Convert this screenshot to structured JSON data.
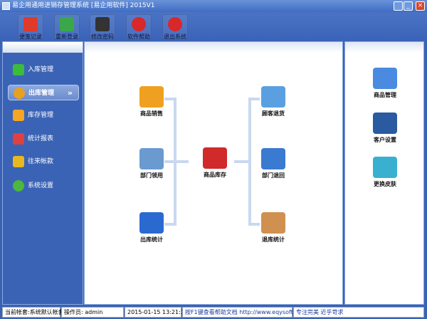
{
  "window": {
    "title": "易企用通用进销存管理系统 [易企用软件] 2015V1",
    "minimize": "_",
    "maximize": "□",
    "close": "×"
  },
  "toolbar": [
    {
      "label": "便笺记录",
      "icon": "notepad-icon",
      "color": "#e03a2a"
    },
    {
      "label": "重新登录",
      "icon": "users-icon",
      "color": "#3aa84a"
    },
    {
      "label": "修改密码",
      "icon": "magic-wand-icon",
      "color": "#333333"
    },
    {
      "label": "软件帮助",
      "icon": "help-icon",
      "color": "#d8282a"
    },
    {
      "label": "退出系统",
      "icon": "power-icon",
      "color": "#d8282a"
    }
  ],
  "sidebar": {
    "items": [
      {
        "label": "入库管理",
        "icon": "plus-icon",
        "color": "#3cbc3c"
      },
      {
        "label": "出库管理",
        "icon": "pie-chart-icon",
        "color": "#e8a020",
        "selected": true,
        "arrow": "»"
      },
      {
        "label": "库存管理",
        "icon": "star-icon",
        "color": "#f5a623"
      },
      {
        "label": "统计报表",
        "icon": "bar-chart-icon",
        "color": "#e04040"
      },
      {
        "label": "往来帐款",
        "icon": "dollar-icon",
        "color": "#e8b820"
      },
      {
        "label": "系统设置",
        "icon": "gear-icon",
        "color": "#4cb83c"
      }
    ]
  },
  "flow": {
    "left": [
      {
        "label": "商品销售",
        "icon": "truck-icon",
        "color": "#f0a020"
      },
      {
        "label": "部门领用",
        "icon": "folder-icon",
        "color": "#6a9ad0"
      },
      {
        "label": "出库统计",
        "icon": "cursor-icon",
        "color": "#2a6ad0"
      }
    ],
    "center": {
      "label": "商品库存",
      "icon": "house-icon",
      "color": "#d02a2a"
    },
    "right": [
      {
        "label": "顾客退货",
        "icon": "cart-icon",
        "color": "#5aa0e0"
      },
      {
        "label": "部门退回",
        "icon": "database-icon",
        "color": "#3a7ad0"
      },
      {
        "label": "退库统计",
        "icon": "box-icon",
        "color": "#d09050"
      }
    ]
  },
  "shortcuts": [
    {
      "label": "商品管理",
      "icon": "documents-icon",
      "color": "#4a8ae0"
    },
    {
      "label": "客户设置",
      "icon": "customers-icon",
      "color": "#2a5aa0"
    },
    {
      "label": "更换皮肤",
      "icon": "cubes-icon",
      "color": "#3ab0d0"
    }
  ],
  "status": {
    "account": "当前帐套:系统默认帐套",
    "operator": "操作员: admin",
    "datetime": "2015-01-15 13:21:16",
    "help": "按F1键查看帮助文档 http://www.eqysoft.com/",
    "slogan": "专注完美 近乎苛求"
  }
}
